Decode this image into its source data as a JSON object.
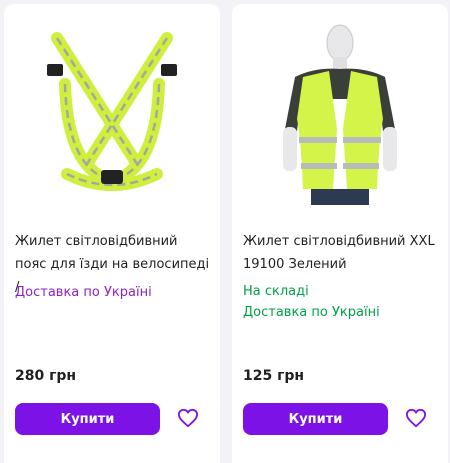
{
  "cards": [
    {
      "image": "reflective-harness-vest-image",
      "title": "Жилет світловідбивний пояс для їзди на велосипеді /",
      "delivery": "Доставка по Україні",
      "price": "280 грн",
      "buy_label": "Купити",
      "fav_icon": "heart-icon"
    },
    {
      "image": "reflective-vest-mannequin-image",
      "title": "Жилет світловідбивний XXL 19100 Зелений",
      "status": "На складі",
      "delivery": "Доставка по Україні",
      "price": "125 грн",
      "buy_label": "Купити",
      "fav_icon": "heart-icon"
    }
  ],
  "colors": {
    "accent": "#7d12e6",
    "delivery_purple": "#8c22c4",
    "in_stock_green": "#00a046",
    "vest_yellow": "#d4f44a"
  }
}
